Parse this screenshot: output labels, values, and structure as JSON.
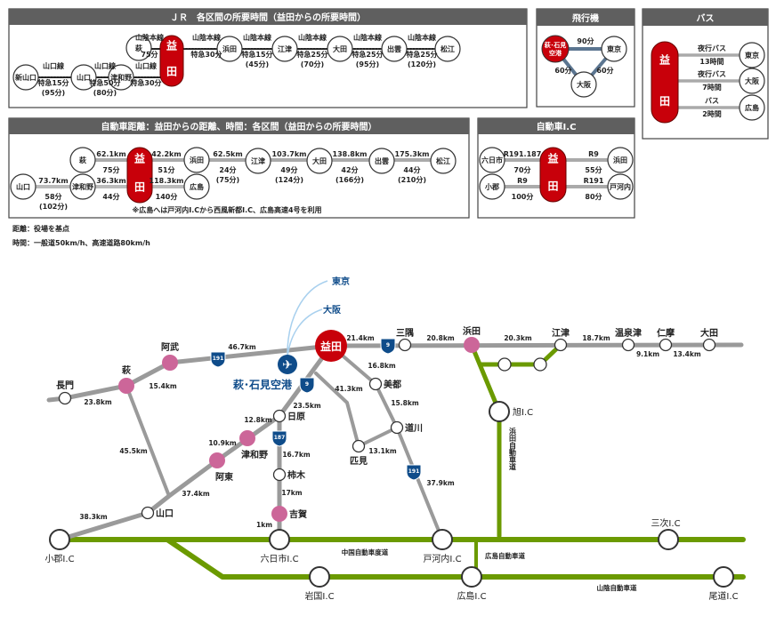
{
  "colors": {
    "header": "#5f5f5f",
    "masuda_red": "#c8000a",
    "pink": "#cc6699",
    "road_gray": "#9a9a9a",
    "expressway_green": "#6b9a00",
    "route_blue": "#0f4c8a",
    "air_line": "#5b7590",
    "sky_line": "#a8d0ee"
  },
  "jr": {
    "title": "ＪＲ　各区間の所要時間（益田からの所要時間）",
    "masuda": [
      "益",
      "田"
    ],
    "stations": {
      "hagi": "萩",
      "hamada": "浜田",
      "gotsu": "江津",
      "oda": "大田",
      "izumo": "出雲",
      "matsue": "松江",
      "shinyamaguchi": "新山口",
      "yamaguchi": "山口",
      "tsuwano": "津和野"
    },
    "segments": [
      [
        "山陰本線",
        "75分"
      ],
      [
        "山陰本線",
        "特急30分"
      ],
      [
        "山陰本線",
        "特急15分",
        "(45分)"
      ],
      [
        "山陰本線",
        "特急25分",
        "(70分)"
      ],
      [
        "山陰本線",
        "特急25分",
        "(95分)"
      ],
      [
        "山陰本線",
        "特急25分",
        "(120分)"
      ],
      [
        "山口線",
        "特急15分",
        "(95分)"
      ],
      [
        "山口線",
        "特急50分",
        "(80分)"
      ],
      [
        "山口線",
        "特急30分"
      ]
    ]
  },
  "air": {
    "title": "飛行機",
    "airport": [
      "萩･石見",
      "空港"
    ],
    "tokyo": "東京",
    "osaka": "大阪",
    "times": [
      "90分",
      "60分",
      "60分"
    ]
  },
  "bus": {
    "title": "バス",
    "masuda": [
      "益",
      "田"
    ],
    "routes": [
      {
        "dest": "東京",
        "type": "夜行バス",
        "time": "13時間"
      },
      {
        "dest": "大阪",
        "type": "夜行バス",
        "time": "7時間"
      },
      {
        "dest": "広島",
        "type": "バス",
        "time": "2時間"
      }
    ]
  },
  "car": {
    "title": "自動車距離：益田からの距離、時間：各区間（益田からの所要時間）",
    "masuda": [
      "益",
      "田"
    ],
    "stations": {
      "hagi": "萩",
      "hamada": "浜田",
      "gotsu": "江津",
      "oda": "大田",
      "izumo": "出雲",
      "matsue": "松江",
      "yamaguchi": "山口",
      "tsuwano": "津和野",
      "hiroshima": "広島"
    },
    "segments": [
      [
        "62.1km",
        "75分"
      ],
      [
        "42.2km",
        "51分"
      ],
      [
        "62.5km",
        "24分",
        "(75分)"
      ],
      [
        "103.7km",
        "49分",
        "(124分)"
      ],
      [
        "138.8km",
        "42分",
        "(166分)"
      ],
      [
        "175.3km",
        "44分",
        "(210分)"
      ],
      [
        "73.7km",
        "58分",
        "(102分)"
      ],
      [
        "36.3km",
        "44分"
      ],
      [
        "118.3km",
        "140分"
      ]
    ],
    "note": "※広島へは戸河内I.Cから西風新都I.C、広島高速4号を利用"
  },
  "ic": {
    "title": "自動車I.C",
    "masuda": [
      "益",
      "田"
    ],
    "stations": {
      "muikaichi": "六日市",
      "ogori": "小郡",
      "hamada": "浜田",
      "togouchi": "戸河内"
    },
    "segments": [
      [
        "R191.187",
        "70分"
      ],
      [
        "R9",
        "100分"
      ],
      [
        "R9",
        "55分"
      ],
      [
        "R191",
        "80分"
      ]
    ]
  },
  "notes": [
    "距離：役場を基点",
    "時間：一般道50km/h、高速道路80km/h"
  ],
  "map": {
    "masuda": "益田",
    "airport": "萩･石見空港",
    "air_dest": [
      "東京",
      "大阪"
    ],
    "places": {
      "misumi": "三隅",
      "hamada": "浜田",
      "gotsu": "江津",
      "yunotsu": "温泉津",
      "nima": "仁摩",
      "oda": "大田",
      "abu": "阿武",
      "hagi": "萩",
      "nagato": "長門",
      "yamaguchi": "山口",
      "ato": "阿東",
      "tsuwano": "津和野",
      "nichihara": "日原",
      "kakinoki": "柿木",
      "yoshika": "吉賀",
      "hikimi": "匹見",
      "misato": "美都",
      "michikawa": "道川"
    },
    "distances": {
      "d1": "21.4km",
      "d2": "20.8km",
      "d3": "20.3km",
      "d4": "18.7km",
      "d5": "9.1km",
      "d6": "13.4km",
      "d7": "46.7km",
      "d8": "15.4km",
      "d9": "23.8km",
      "d10": "45.5km",
      "d11": "23.5km",
      "d12": "12.8km",
      "d13": "10.9km",
      "d14": "37.4km",
      "d15": "16.7km",
      "d16": "17km",
      "d17": "1km",
      "d18": "41.3km",
      "d19": "13.1km",
      "d20": "16.8km",
      "d21": "15.8km",
      "d22": "37.9km",
      "d23": "38.3km"
    },
    "routes": {
      "r9": "9",
      "r191": "191",
      "r187": "187"
    },
    "ics": {
      "ogori": "小郡I.C",
      "muikaichi": "六日市I.C",
      "togouchi": "戸河内I.C",
      "miyoshi": "三次I.C",
      "iwakuni": "岩国I.C",
      "hiroshima": "広島I.C",
      "onomichi": "尾道I.C",
      "asahi": "旭I.C"
    },
    "expressways": {
      "chugoku": "中国自動車度道",
      "hiroshima": "広島自動車道",
      "sanyo": "山陰自動車道",
      "hamada": "浜田自動車道"
    }
  }
}
